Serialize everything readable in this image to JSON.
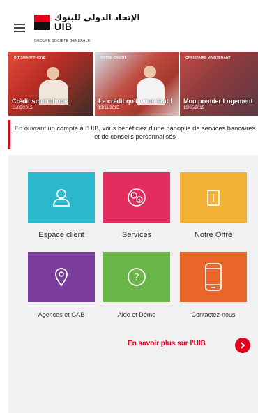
{
  "header": {
    "logo_arabic": "الإتحاد الدولي للبنوك",
    "logo_name": "UIB",
    "logo_group": "GROUPE SOCIETE GENERALE"
  },
  "carousel": [
    {
      "caption": "Crédit smartphone",
      "date": "11/05/2015",
      "top_text": "DIT SMARTPHONE"
    },
    {
      "caption": "Le crédit qu'il vous faut !",
      "date": "13/11/2015",
      "top_text": "VOTRE CREDIT"
    },
    {
      "caption": "Mon premier Logement",
      "date": "10/05/2015",
      "top_text": "OPRIETAIRE MAINTENANT"
    }
  ],
  "info_text": "En ouvrant un compte à l'UIB, vous bénéficiez d'une panoplie de services bancaires et de conseils personnalisés",
  "tiles": [
    {
      "label": "Espace client",
      "color": "#2bb7cd",
      "icon": "user-icon"
    },
    {
      "label": "Services",
      "color": "#e22d5e",
      "icon": "money-icon"
    },
    {
      "label": "Notre Offre",
      "color": "#f2b134",
      "icon": "document-icon"
    },
    {
      "label": "Agences et GAB",
      "color": "#7b3d9b",
      "icon": "location-pin-icon"
    },
    {
      "label": "Aide et Démo",
      "color": "#6ab548",
      "icon": "help-icon"
    },
    {
      "label": "Contactez-nous",
      "color": "#e8662a",
      "icon": "phone-icon"
    }
  ],
  "more_link": "En savoir plus sur l'UIB",
  "colors": {
    "brand": "#e2001a",
    "panel": "#f1f1f1"
  }
}
